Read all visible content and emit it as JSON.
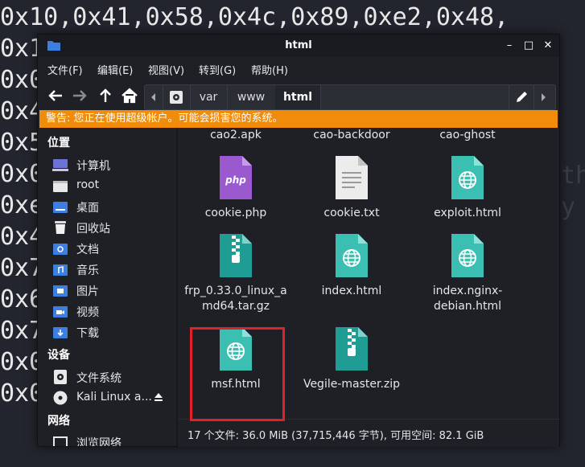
{
  "terminal": {
    "lines": [
      "0x10,0x41,0x58,0x4c,0x89,0xe2,0x48,",
      "0x1",
      "0x0",
      "0x4",
      "0x5",
      "0x0",
      "0xe",
      "0x4",
      "0x7",
      "0x6",
      "0x7",
      "0x0",
      "0x0"
    ],
    "ghost_text": [
      "th",
      "y"
    ]
  },
  "window": {
    "title": "html",
    "controls": {
      "minimize": "–",
      "maximize": "□",
      "close": "✕"
    }
  },
  "menu": [
    "文件(F)",
    "编辑(E)",
    "视图(V)",
    "转到(G)",
    "帮助(H)"
  ],
  "path": {
    "crumbs": [
      "var",
      "www",
      "html"
    ],
    "active": "html"
  },
  "warning": "警告: 您正在使用超级帐户。可能会损害您的系统。",
  "sidebar": {
    "places_header": "位置",
    "places": [
      {
        "label": "计算机",
        "icon": "computer-icon"
      },
      {
        "label": "root",
        "icon": "home-folder-icon"
      },
      {
        "label": "桌面",
        "icon": "desktop-folder-icon"
      },
      {
        "label": "回收站",
        "icon": "trash-icon"
      },
      {
        "label": "文档",
        "icon": "documents-folder-icon"
      },
      {
        "label": "音乐",
        "icon": "music-folder-icon"
      },
      {
        "label": "图片",
        "icon": "pictures-folder-icon"
      },
      {
        "label": "视频",
        "icon": "videos-folder-icon"
      },
      {
        "label": "下载",
        "icon": "downloads-folder-icon"
      }
    ],
    "devices_header": "设备",
    "devices": [
      {
        "label": "文件系统",
        "icon": "drive-icon"
      },
      {
        "label": "Kali Linux a...",
        "icon": "disc-icon"
      }
    ],
    "network_header": "网络",
    "network": [
      {
        "label": "浏览网络",
        "icon": "network-icon"
      }
    ]
  },
  "files": [
    {
      "name": "cao2.apk",
      "type": "partial"
    },
    {
      "name": "cao-backdoor",
      "type": "partial"
    },
    {
      "name": "cao-ghost",
      "type": "partial"
    },
    {
      "name": "cookie.php",
      "type": "php"
    },
    {
      "name": "cookie.txt",
      "type": "text"
    },
    {
      "name": "exploit.html",
      "type": "html"
    },
    {
      "name": "frp_0.33.0_linux_amd64.tar.gz",
      "display": [
        "frp_0.33.0_linux_a",
        "md64.tar.gz"
      ],
      "type": "archive"
    },
    {
      "name": "index.html",
      "type": "html"
    },
    {
      "name": "index.nginx-debian.html",
      "display": [
        "index.nginx-",
        "debian.html"
      ],
      "type": "html"
    },
    {
      "name": "msf.html",
      "type": "html"
    },
    {
      "name": "Vegile-master.zip",
      "type": "archive"
    }
  ],
  "status": "17 个文件: 36.0 MiB (37,715,446 字节), 可用空间: 82.1 GiB",
  "colors": {
    "warning": "#f08c0a",
    "html_icon": "#3bbfb3",
    "php_icon": "#9b59d0",
    "highlight": "#e0202a"
  }
}
